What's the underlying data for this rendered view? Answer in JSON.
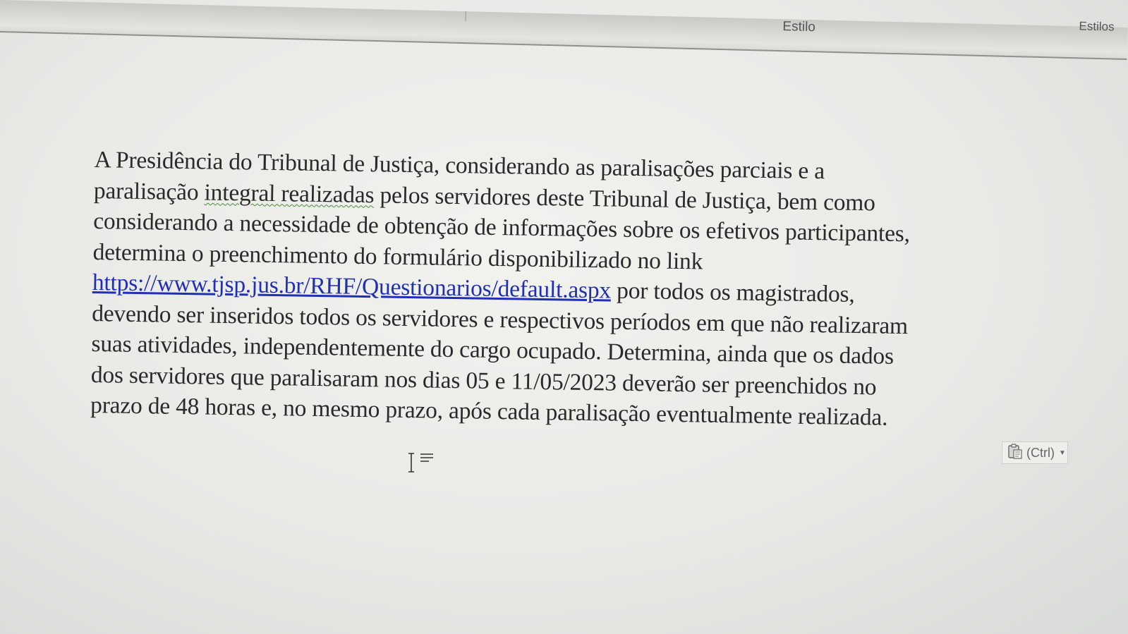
{
  "ribbon": {
    "group_label": "Estilo",
    "group_label_2": "Estilos"
  },
  "document": {
    "line_1": "A Presidência do Tribunal de Justiça, considerando as paralisações parciais e a",
    "line_2a": "paralisação ",
    "line_2_flagged": "integral realizadas",
    "line_2b": " pelos servidores deste Tribunal de Justiça, bem como",
    "line_3": "considerando a necessidade de obtenção de informações sobre os efetivos participantes,",
    "line_4": "determina o preenchimento do formulário disponibilizado no link",
    "link": "https://www.tjsp.jus.br/RHF/Questionarios/default.aspx",
    "line_5b": " por todos os magistrados,",
    "line_6": "devendo ser inseridos todos os servidores e respectivos períodos em que não realizaram",
    "line_7": "suas atividades, independentemente do cargo ocupado. Determina, ainda que os dados",
    "line_8": "dos servidores que paralisaram nos dias 05 e 11/05/2023 deverão ser preenchidos no",
    "line_9": "prazo de 48 horas e, no mesmo prazo, após cada paralisação eventualmente realizada."
  },
  "paste_options": {
    "label": "(Ctrl)",
    "icon": "clipboard-icon"
  },
  "cursor": {
    "icon": "ibeam-cursor-icon"
  }
}
